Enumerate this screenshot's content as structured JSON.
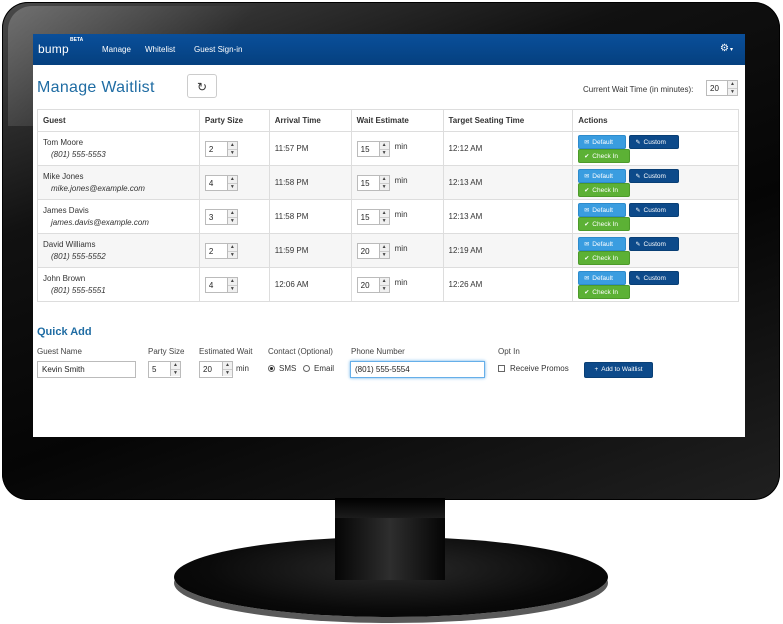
{
  "navbar": {
    "brand": "bump",
    "brand_badge": "BETA",
    "links": [
      "Manage",
      "Whitelist",
      "Guest Sign-in"
    ],
    "settings_icon": "gear-icon"
  },
  "page": {
    "title": "Manage Waitlist",
    "refresh_icon": "refresh-icon",
    "current_wait_label": "Current Wait Time (in minutes):",
    "current_wait_value": "20"
  },
  "table": {
    "headers": [
      "Guest",
      "Party Size",
      "Arrival Time",
      "Wait Estimate",
      "Target Seating Time",
      "Actions"
    ],
    "rows": [
      {
        "name": "Tom Moore",
        "contact": "(801) 555-5553",
        "party": "2",
        "arrival": "11:57 PM",
        "wait": "15",
        "target": "12:12 AM"
      },
      {
        "name": "Mike Jones",
        "contact": "mike.jones@example.com",
        "party": "4",
        "arrival": "11:58 PM",
        "wait": "15",
        "target": "12:13 AM"
      },
      {
        "name": "James Davis",
        "contact": "james.davis@example.com",
        "party": "3",
        "arrival": "11:58 PM",
        "wait": "15",
        "target": "12:13 AM"
      },
      {
        "name": "David Williams",
        "contact": "(801) 555-5552",
        "party": "2",
        "arrival": "11:59 PM",
        "wait": "20",
        "target": "12:19 AM"
      },
      {
        "name": "John Brown",
        "contact": "(801) 555-5551",
        "party": "4",
        "arrival": "12:06 AM",
        "wait": "20",
        "target": "12:26 AM"
      }
    ],
    "min_label": "min",
    "actions": {
      "default": "Default",
      "custom": "Custom",
      "checkin": "Check In"
    }
  },
  "quick_add": {
    "title": "Quick Add",
    "guest_name_label": "Guest Name",
    "guest_name_value": "Kevin Smith",
    "party_size_label": "Party Size",
    "party_size_value": "5",
    "est_wait_label": "Estimated Wait",
    "est_wait_value": "20",
    "min_label": "min",
    "contact_label": "Contact (Optional)",
    "contact_options": [
      "SMS",
      "Email"
    ],
    "contact_selected": "SMS",
    "phone_label": "Phone Number",
    "phone_value": "(801) 555-5554",
    "optin_label": "Opt In",
    "optin_checkbox_label": "Receive Promos",
    "optin_checked": false,
    "add_button": "Add to Waitlist"
  },
  "colors": {
    "navbar": "#05407f",
    "title": "#1f6ca3",
    "btn_default": "#3a9de0",
    "btn_custom": "#0d4a8a",
    "btn_checkin": "#5cb135"
  }
}
